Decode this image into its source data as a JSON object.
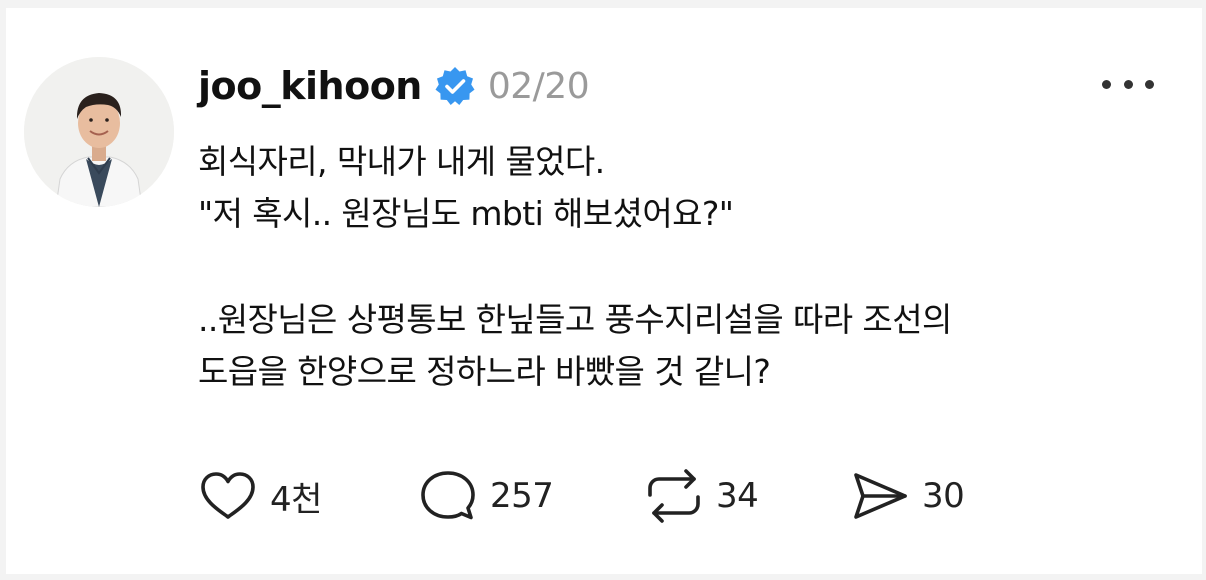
{
  "post": {
    "author": {
      "username": "joo_kihoon",
      "verified": true,
      "verified_icon": "verified-badge-icon",
      "avatar": "profile-photo"
    },
    "date": "02/20",
    "body": {
      "paragraph1": [
        "회식자리, 막내가 내게 물었다.",
        "\"저 혹시.. 원장님도 mbti 해보셨어요?\""
      ],
      "paragraph2": [
        "..원장님은 상평통보 한닢들고 풍수지리설을 따라 조선의",
        "도읍을 한양으로 정하느라 바빴을 것 같니?"
      ]
    },
    "actions": {
      "like": {
        "icon": "heart-icon",
        "count": "4천"
      },
      "reply": {
        "icon": "comment-bubble-icon",
        "count": "257"
      },
      "repost": {
        "icon": "repost-icon",
        "count": "34"
      },
      "share": {
        "icon": "send-icon",
        "count": "30"
      }
    },
    "more_icon": "more-options-icon"
  },
  "colors": {
    "verified": "#3897f0",
    "date": "#9a9a9a",
    "text": "#111111",
    "background": "#ffffff"
  }
}
